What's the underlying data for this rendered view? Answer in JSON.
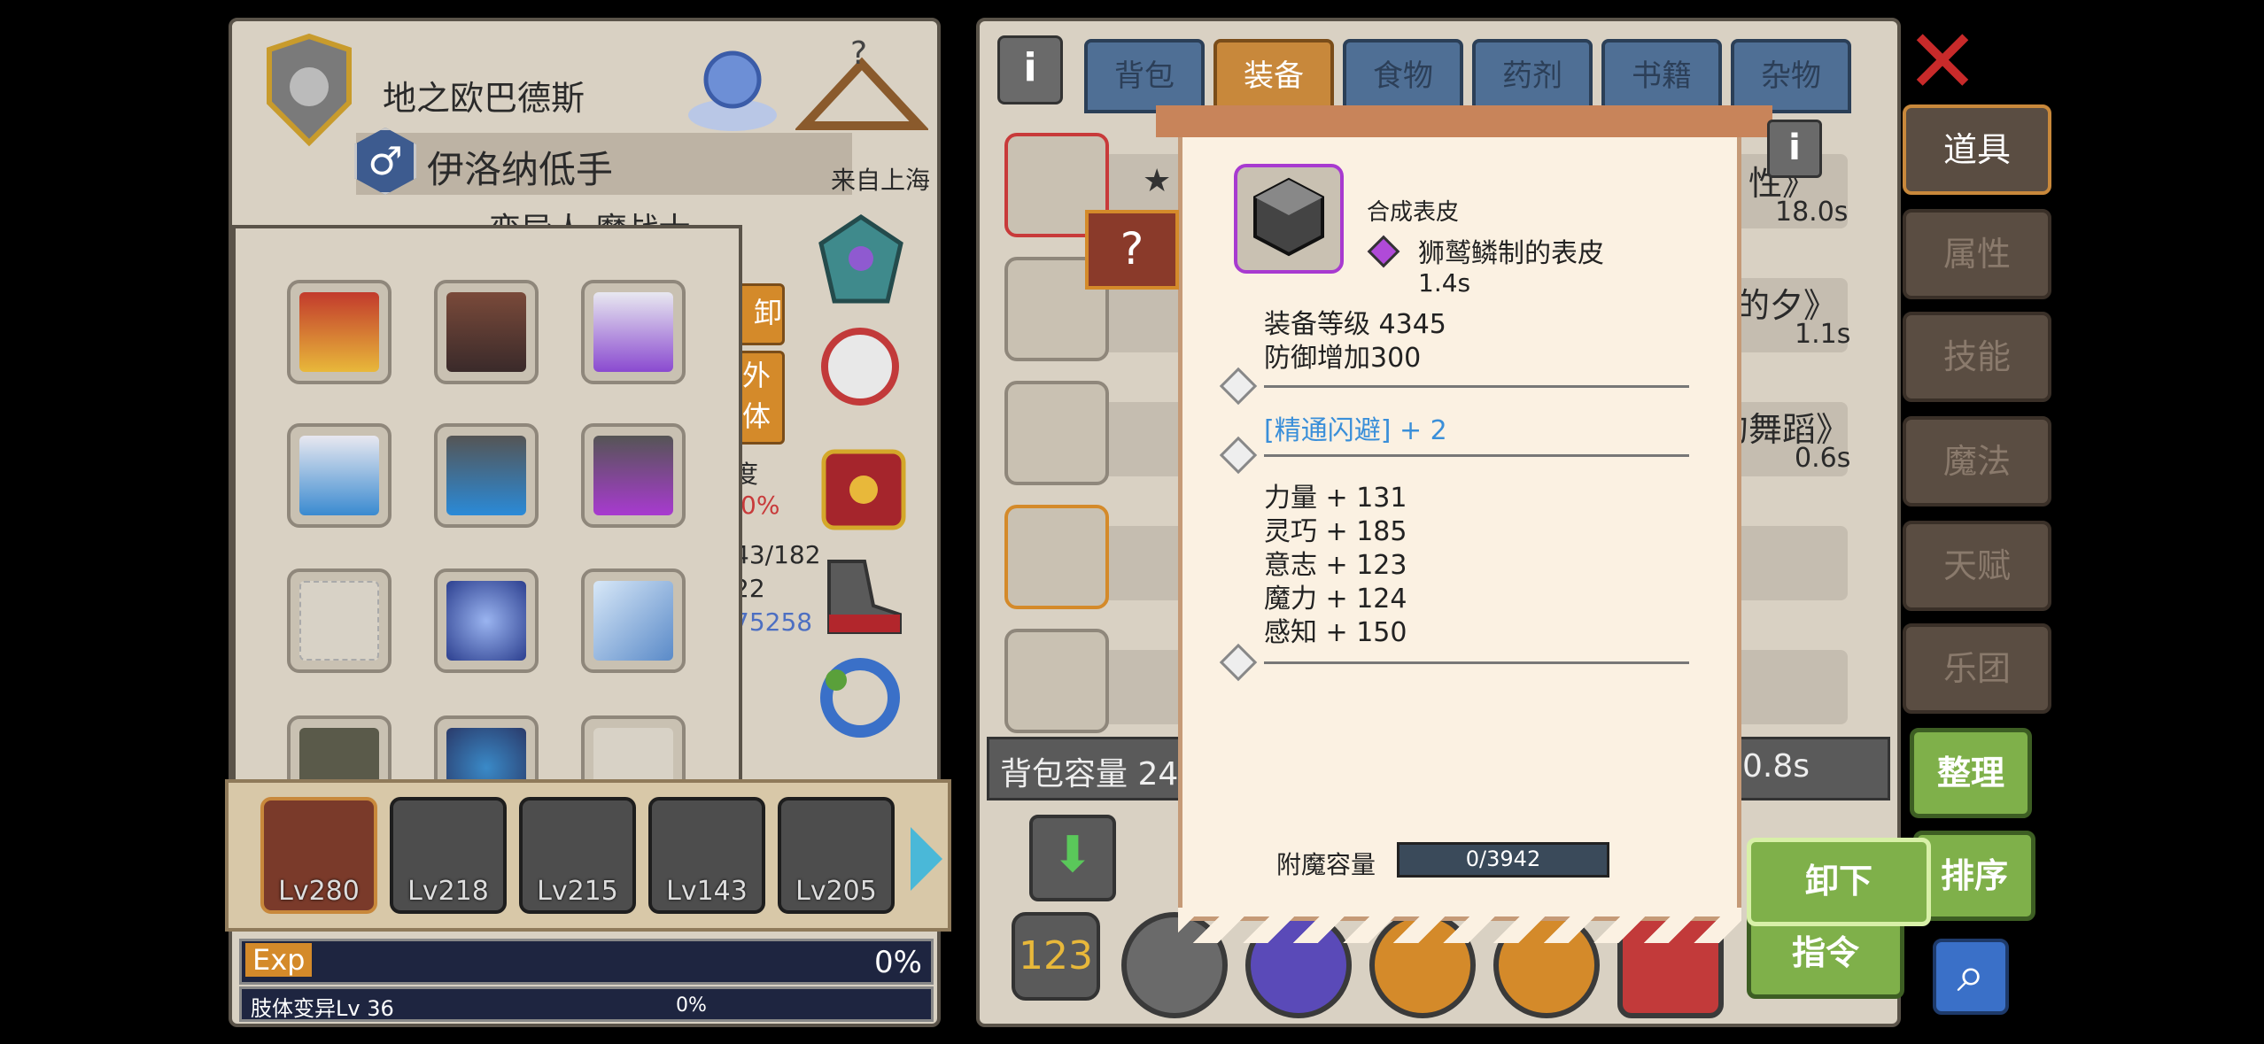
{
  "character": {
    "guild": "地之欧巴德斯",
    "name": "伊洛纳低手",
    "origin": "来自上海",
    "race_class": "变异人 魔战士",
    "partial_labels": [
      "卸",
      "外",
      "体",
      "度",
      "0%",
      "43/182",
      "22",
      "75258"
    ]
  },
  "party": [
    {
      "level": "Lv280"
    },
    {
      "level": "Lv218"
    },
    {
      "level": "Lv215"
    },
    {
      "level": "Lv143"
    },
    {
      "level": "Lv205"
    }
  ],
  "exp": {
    "label": "Exp",
    "percent": "0%"
  },
  "mutation": {
    "label": "肢体变异Lv 36",
    "percent": "0%"
  },
  "tabs": [
    {
      "label": "背包"
    },
    {
      "label": "装备"
    },
    {
      "label": "食物"
    },
    {
      "label": "药剂"
    },
    {
      "label": "书籍"
    },
    {
      "label": "杂物"
    }
  ],
  "item_rows": [
    {
      "title_suffix": "性》",
      "time": "18.0s"
    },
    {
      "title_suffix": "的夕》",
      "time": "1.1s"
    },
    {
      "title_suffix": "的舞蹈》",
      "time": "0.6s"
    }
  ],
  "bag_capacity_label": "背包容量 24",
  "bag_time": "0.8s",
  "side_menu": [
    "道具",
    "属性",
    "技能",
    "魔法",
    "天赋",
    "乐团"
  ],
  "buttons": {
    "organize": "整理",
    "sort": "排序",
    "unequip": "卸下",
    "command": "指令"
  },
  "tooltip": {
    "category": "合成表皮",
    "item_name": "狮鹫鳞制的表皮",
    "time": "1.4s",
    "equip_level": "装备等级 4345",
    "defense": "防御增加300",
    "skill_bonus": "[精通闪避] + 2",
    "stats": [
      "力量 + 131",
      "灵巧 + 185",
      "意志 + 123",
      "魔力 + 124",
      "感知 + 150"
    ],
    "enchant_label": "附魔容量",
    "enchant_value": "0/3942"
  },
  "colors": {
    "accent": "#c8883b",
    "panel": "#d9d1c3",
    "skill_blue": "#3a8fd9",
    "green": "#7fb04a"
  }
}
